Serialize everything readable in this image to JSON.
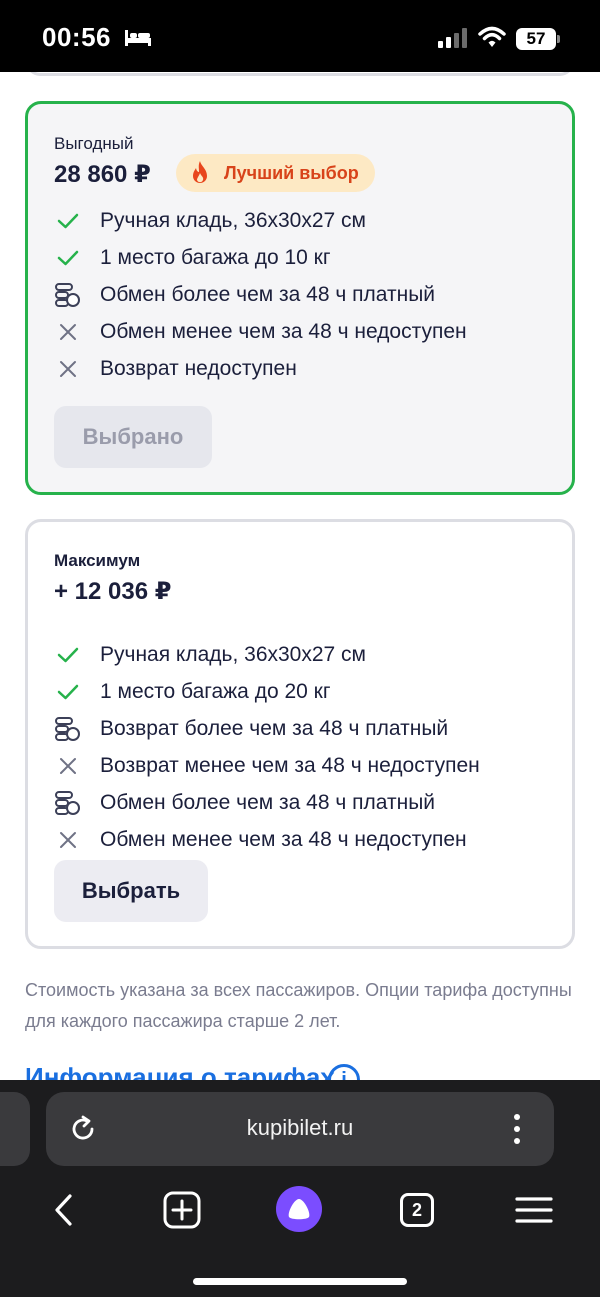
{
  "status_bar": {
    "time": "00:56",
    "battery": "57"
  },
  "tariffs": [
    {
      "name": "Выгодный",
      "price": "28 860 ₽",
      "badge": "Лучший выбор",
      "features": [
        {
          "icon": "check-icon",
          "label": "Ручная кладь, 36x30x27 см"
        },
        {
          "icon": "check-icon",
          "label": "1 место багажа до 10 кг"
        },
        {
          "icon": "coins-icon",
          "label": "Обмен более чем за 48 ч платный"
        },
        {
          "icon": "cross-icon",
          "label": "Обмен менее чем за 48 ч недоступен"
        },
        {
          "icon": "cross-icon",
          "label": "Возврат недоступен"
        }
      ],
      "button": "Выбрано"
    },
    {
      "name": "Максимум",
      "price": "+ 12 036 ₽",
      "features": [
        {
          "icon": "check-icon",
          "label": "Ручная кладь, 36x30x27 см"
        },
        {
          "icon": "check-icon",
          "label": "1 место багажа до 20 кг"
        },
        {
          "icon": "coins-icon",
          "label": "Возврат более чем за 48 ч платный"
        },
        {
          "icon": "cross-icon",
          "label": "Возврат менее чем за 48 ч недоступен"
        },
        {
          "icon": "coins-icon",
          "label": "Обмен более чем за 48 ч платный"
        },
        {
          "icon": "cross-icon",
          "label": "Обмен менее чем за 48 ч недоступен"
        }
      ],
      "button": "Выбрать"
    }
  ],
  "footnote": "Стоимость указана за всех пассажиров. Опции тарифа доступны для каждого пассажира старше 2 лет.",
  "info_link": "Информация о тарифах",
  "browser": {
    "url": "kupibilet.ru",
    "tab_count": "2"
  },
  "colors": {
    "selected_border": "#26b24b",
    "check": "#26b24b",
    "badge_bg": "#fde9c4",
    "badge_text": "#d8431a",
    "link": "#1a6fe0",
    "alice": "#7b4dff"
  }
}
